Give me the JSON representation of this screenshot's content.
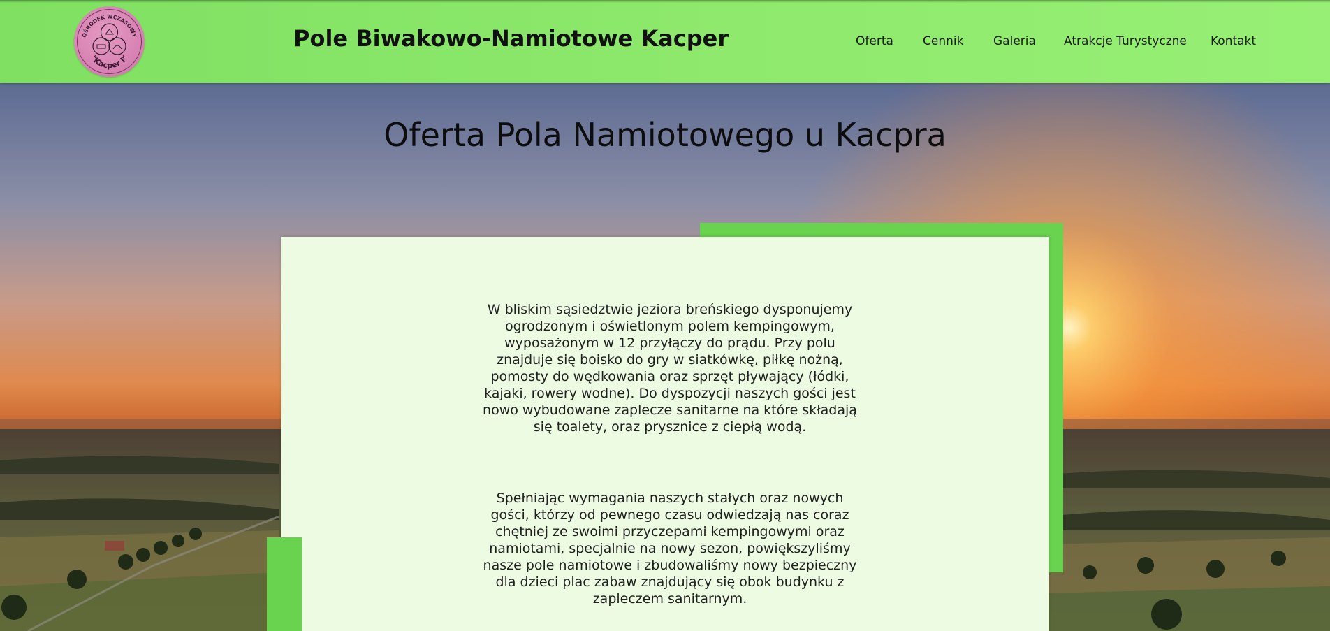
{
  "header": {
    "logo": {
      "arc_text_top": "OŚRODEK WCZASOWY",
      "arc_text_bottom": "\"Kacper I\""
    },
    "site_title": "Pole Biwakowo-Namiotowe Kacper",
    "nav": [
      "Oferta",
      "Cennik",
      "Galeria",
      "Atrakcje Turystyczne",
      "Kontakt"
    ]
  },
  "main": {
    "heading": "Oferta Pola Namiotowego u Kacpra",
    "paragraphs": [
      "W bliskim sąsiedztwie jeziora breńskiego dysponujemy ogrodzonym i oświetlonym polem kempingowym, wyposażonym w 12 przyłączy do prądu. Przy polu znajduje się boisko do gry w siatkówkę, piłkę nożną, pomosty do wędkowania oraz sprzęt pływający (łódki, kajaki, rowery wodne). Do dyspozycji naszych gości jest nowo wybudowane zaplecze sanitarne na które składają się toalety, oraz prysznice z ciepłą wodą.",
      "Spełniając wymagania naszych stałych oraz nowych gości, którzy od pewnego czasu odwiedzają nas coraz chętniej ze swoimi przyczepami kempingowymi oraz namiotami, specjalnie na nowy sezon, powiększyliśmy nasze pole namiotowe i zbudowaliśmy nowy bezpieczny dla dzieci plac zabaw znajdujący się obok budynku z zapleczem sanitarnym."
    ]
  },
  "colors": {
    "header_green": "#8ee96c",
    "accent_green": "#69d24f",
    "card_background": "#eefbe3",
    "logo_pink": "#d57fb1"
  }
}
